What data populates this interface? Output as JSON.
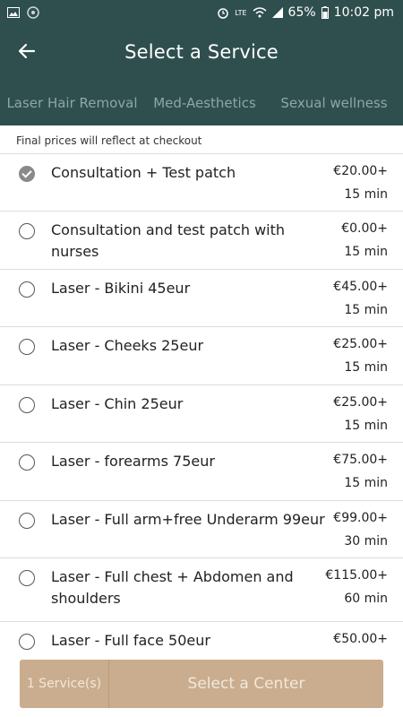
{
  "status_bar": {
    "battery": "65%",
    "time": "10:02 pm",
    "network": "LTE"
  },
  "header": {
    "title": "Select a Service"
  },
  "tabs": [
    {
      "label": "Laser Hair Removal",
      "active": true
    },
    {
      "label": "Med-Aesthetics",
      "active": false
    },
    {
      "label": "Sexual wellness",
      "active": false
    }
  ],
  "notice": "Final prices will reflect at checkout",
  "services": [
    {
      "name": "Consultation + Test patch",
      "price": "€20.00+",
      "duration": "15 min",
      "selected": true
    },
    {
      "name": "Consultation and test patch with nurses",
      "price": "€0.00+",
      "duration": "15 min",
      "selected": false
    },
    {
      "name": "Laser - Bikini 45eur",
      "price": "€45.00+",
      "duration": "15 min",
      "selected": false
    },
    {
      "name": "Laser - Cheeks 25eur",
      "price": "€25.00+",
      "duration": "15 min",
      "selected": false
    },
    {
      "name": "Laser - Chin 25eur",
      "price": "€25.00+",
      "duration": "15 min",
      "selected": false
    },
    {
      "name": "Laser - forearms 75eur",
      "price": "€75.00+",
      "duration": "15 min",
      "selected": false
    },
    {
      "name": "Laser - Full arm+free Underarm 99eur",
      "price": "€99.00+",
      "duration": "30 min",
      "selected": false
    },
    {
      "name": "Laser - Full chest + Abdomen and shoulders",
      "price": "€115.00+",
      "duration": "60 min",
      "selected": false
    },
    {
      "name": "Laser - Full face 50eur",
      "price": "€50.00+",
      "duration": "",
      "selected": false
    }
  ],
  "bottom": {
    "count_label": "1 Service(s)",
    "center_label": "Select a Center"
  },
  "colors": {
    "primary": "#2f4f4f",
    "accent": "#c9ad8e"
  }
}
